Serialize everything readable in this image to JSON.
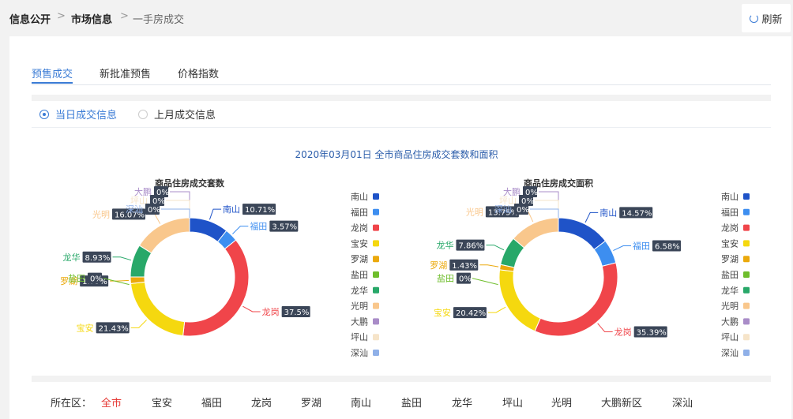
{
  "breadcrumb": {
    "items": [
      "信息公开",
      "市场信息",
      "一手房成交"
    ],
    "separator": ">"
  },
  "refresh": {
    "label": "刷新",
    "icon": "refresh-icon"
  },
  "tabs": [
    {
      "label": "预售成交",
      "active": true
    },
    {
      "label": "新批准预售",
      "active": false
    },
    {
      "label": "价格指数",
      "active": false
    }
  ],
  "radios": [
    {
      "label": "当日成交信息",
      "checked": true
    },
    {
      "label": "上月成交信息",
      "checked": false
    }
  ],
  "page_title": "2020年03月01日 全市商品住房成交套数和面积",
  "colors": {
    "accent": "#3a7bd5",
    "南山": "#1f53c8",
    "福田": "#3d8ef0",
    "龙岗": "#f0454a",
    "宝安": "#f5d80f",
    "罗湖": "#eba90c",
    "盐田": "#6fbe2c",
    "龙华": "#28a869",
    "光明": "#f9c78c",
    "大鹏": "#a98cc8",
    "坪山": "#f6e4c9",
    "深汕": "#8fb0e8"
  },
  "chart_data": [
    {
      "type": "pie",
      "title": "商品住房成交套数",
      "categories": [
        "南山",
        "福田",
        "龙岗",
        "宝安",
        "罗湖",
        "盐田",
        "龙华",
        "光明",
        "大鹏",
        "坪山",
        "深汕"
      ],
      "values": [
        10.71,
        3.57,
        37.5,
        21.43,
        1.79,
        0,
        8.93,
        16.07,
        0,
        0,
        0
      ],
      "labels": [
        "10.71%",
        "3.57%",
        "37.5%",
        "21.43%",
        "1.79%",
        "0%",
        "8.93%",
        "16.07%",
        "0%",
        "0%",
        "0%"
      ],
      "legend_position": "right"
    },
    {
      "type": "pie",
      "title": "商品住房成交面积",
      "categories": [
        "南山",
        "福田",
        "龙岗",
        "宝安",
        "罗湖",
        "盐田",
        "龙华",
        "光明",
        "大鹏",
        "坪山",
        "深汕"
      ],
      "values": [
        14.57,
        6.58,
        35.39,
        20.42,
        1.43,
        0,
        7.86,
        13.75,
        0,
        0,
        0
      ],
      "labels": [
        "14.57%",
        "6.58%",
        "35.39%",
        "20.42%",
        "1.43%",
        "0%",
        "7.86%",
        "13.75%",
        "0%",
        "0%",
        "0%"
      ],
      "legend_position": "right"
    }
  ],
  "district_filter": {
    "label": "所在区：",
    "items": [
      "全市",
      "宝安",
      "福田",
      "龙岗",
      "罗湖",
      "南山",
      "盐田",
      "龙华",
      "坪山",
      "光明",
      "大鹏新区",
      "深汕"
    ],
    "selected": "全市"
  }
}
